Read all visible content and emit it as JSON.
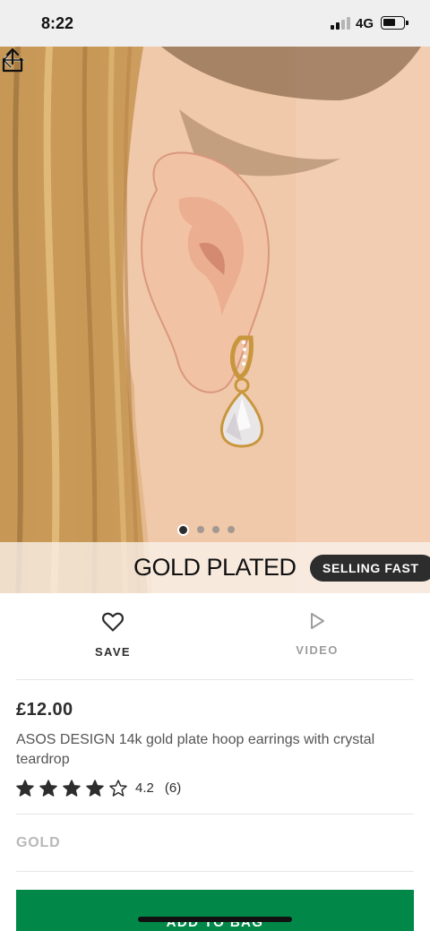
{
  "status_bar": {
    "time": "8:22",
    "network": "4G"
  },
  "product_image": {
    "banner_text": "GOLD PLATED",
    "badge": "SELLING FAST",
    "image_count": 4,
    "active_image": 1
  },
  "actions": {
    "save_label": "SAVE",
    "video_label": "VIDEO"
  },
  "product": {
    "price": "£12.00",
    "title": "ASOS DESIGN 14k gold plate hoop earrings with crystal teardrop",
    "rating_value": "4.2",
    "rating_count": "(6)",
    "stars_filled": 4,
    "stars_total": 5,
    "colour": "GOLD"
  },
  "add_to_bag_label": "ADD TO BAG",
  "colors": {
    "primary_button": "#018849",
    "badge_bg": "#2d2d2d",
    "text": "#2d2d2d"
  }
}
